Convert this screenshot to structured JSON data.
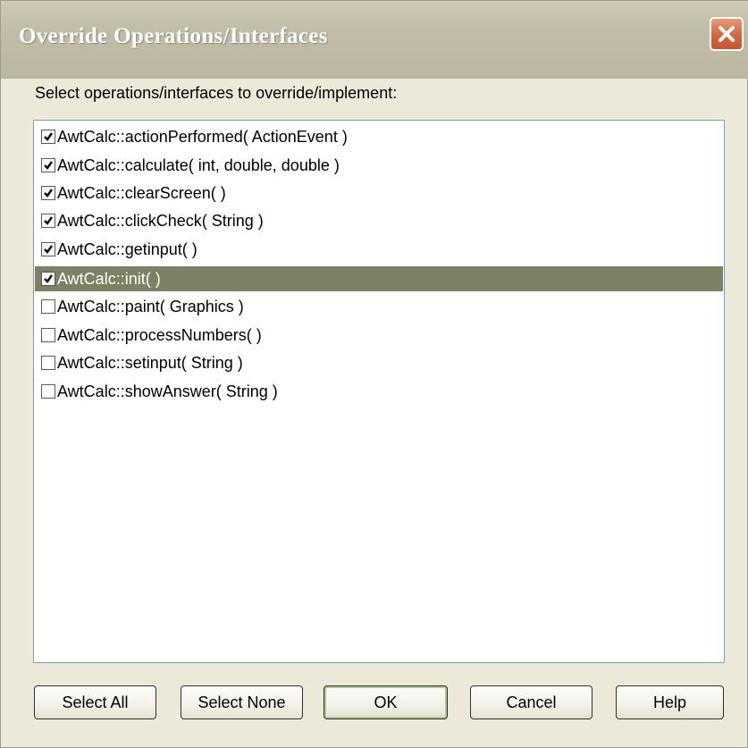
{
  "window": {
    "title": "Override Operations/Interfaces",
    "close_icon": "close-icon"
  },
  "prompt": "Select operations/interfaces to override/implement:",
  "operations": [
    {
      "label": "AwtCalc::actionPerformed( ActionEvent )",
      "checked": true,
      "selected": false
    },
    {
      "label": "AwtCalc::calculate( int, double, double )",
      "checked": true,
      "selected": false
    },
    {
      "label": "AwtCalc::clearScreen(  )",
      "checked": true,
      "selected": false
    },
    {
      "label": "AwtCalc::clickCheck( String )",
      "checked": true,
      "selected": false
    },
    {
      "label": "AwtCalc::getinput(  )",
      "checked": true,
      "selected": false
    },
    {
      "label": "AwtCalc::init(  )",
      "checked": true,
      "selected": true
    },
    {
      "label": "AwtCalc::paint( Graphics )",
      "checked": false,
      "selected": false
    },
    {
      "label": "AwtCalc::processNumbers(  )",
      "checked": false,
      "selected": false
    },
    {
      "label": "AwtCalc::setinput( String )",
      "checked": false,
      "selected": false
    },
    {
      "label": "AwtCalc::showAnswer( String )",
      "checked": false,
      "selected": false
    }
  ],
  "buttons": {
    "select_all": "Select All",
    "select_none": "Select None",
    "ok": "OK",
    "cancel": "Cancel",
    "help": "Help"
  },
  "colors": {
    "selection": "#7f8164",
    "title_text": "#ffffff",
    "close_button": "#d9683f"
  }
}
